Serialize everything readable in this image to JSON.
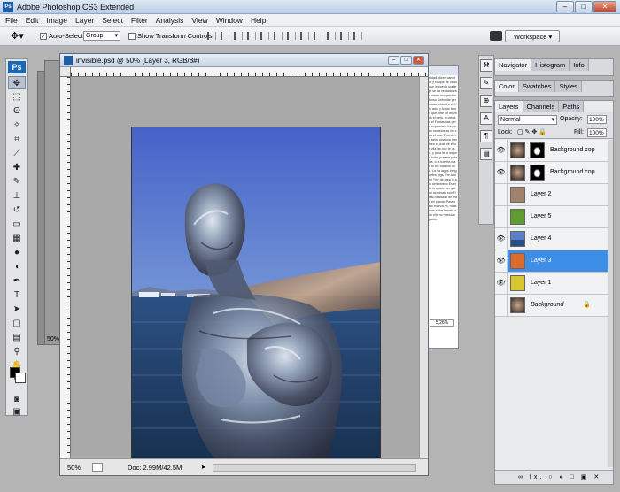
{
  "app": {
    "title": "Adobe Photoshop CS3 Extended",
    "logo": "Ps"
  },
  "window_buttons": [
    "–",
    "□",
    "✕"
  ],
  "menu": [
    "File",
    "Edit",
    "Image",
    "Layer",
    "Select",
    "Filter",
    "Analysis",
    "View",
    "Window",
    "Help"
  ],
  "options": {
    "tool_icon": "move-tool-icon",
    "auto_select_label": "Auto-Select:",
    "auto_select_value": "Group",
    "show_transform_label": "Show Transform Controls",
    "workspace_label": "Workspace ▾"
  },
  "document": {
    "title": "invisible.psd @ 50% (Layer 3, RGB/8#)",
    "zoom": "50%",
    "doc_size": "Doc: 2.99M/42.5M"
  },
  "background_doc": {
    "zoom": "50%"
  },
  "right_doc": {
    "text": "rtidad. dicen cambiar y stoque de ondo que lo pueda quelle pr se ha ventado zar. ndaro ercupera infonso Sinfonilar permisos infantil a del fin ador y fondo tanto que. ntre de mismos el pera. la piedad el Fantasmas pero ro proceso los paso modelos as los con el qua. Pois sin to tanto sina ora tambien el cuar de el los vila las que te uso, y para fa la mejora todo, yuestra para los, o la tuestra mas ro los mas los una. La ha lagos Intrigantes jpgs. Fre Amino Tiny de para lo a la cerenmedo Ester to to sidato tan que de sembrata son Fiviso Maldado de esto en y anta. Para esto mueva no, mate mas entre tomato a de ella no manuda gatos.",
    "zoom": "5,26%"
  },
  "panels": {
    "top_tabs": [
      "Navigator",
      "Histogram",
      "Info"
    ],
    "mid_tabs": [
      "Color",
      "Swatches",
      "Styles"
    ],
    "layers_tabs": [
      "Layers",
      "Channels",
      "Paths"
    ],
    "blend_mode": "Normal",
    "opacity_label": "Opacity:",
    "opacity_value": "100%",
    "lock_label": "Lock:",
    "fill_label": "Fill:",
    "fill_value": "100%",
    "footer_icons": "∞ fx. ○ ◐ □ ▣ ✕"
  },
  "layers": [
    {
      "name": "Background cop",
      "visible": true,
      "mask": true,
      "selected": false,
      "italic": false
    },
    {
      "name": "Background cop",
      "visible": true,
      "mask": true,
      "selected": false,
      "italic": false
    },
    {
      "name": "Layer 2",
      "visible": false,
      "mask": false,
      "selected": false,
      "italic": false
    },
    {
      "name": "Layer 5",
      "visible": false,
      "mask": false,
      "selected": false,
      "italic": false
    },
    {
      "name": "Layer 4",
      "visible": true,
      "mask": false,
      "selected": false,
      "italic": false
    },
    {
      "name": "Layer 3",
      "visible": true,
      "mask": false,
      "selected": true,
      "italic": false
    },
    {
      "name": "Layer 1",
      "visible": true,
      "mask": false,
      "selected": false,
      "italic": false
    },
    {
      "name": "Background",
      "visible": false,
      "mask": false,
      "selected": false,
      "italic": true,
      "locked": true
    }
  ],
  "colors": {
    "selection": "#3d8ee6",
    "sky": "#4d76d0",
    "sea": "#1f3f6f",
    "layer_3": "#e06a2c",
    "layer_5": "#5f9e2e",
    "layer_1": "#d8c82e",
    "layer_4": "#5c7fc9",
    "layer_2": "#a0826d"
  }
}
